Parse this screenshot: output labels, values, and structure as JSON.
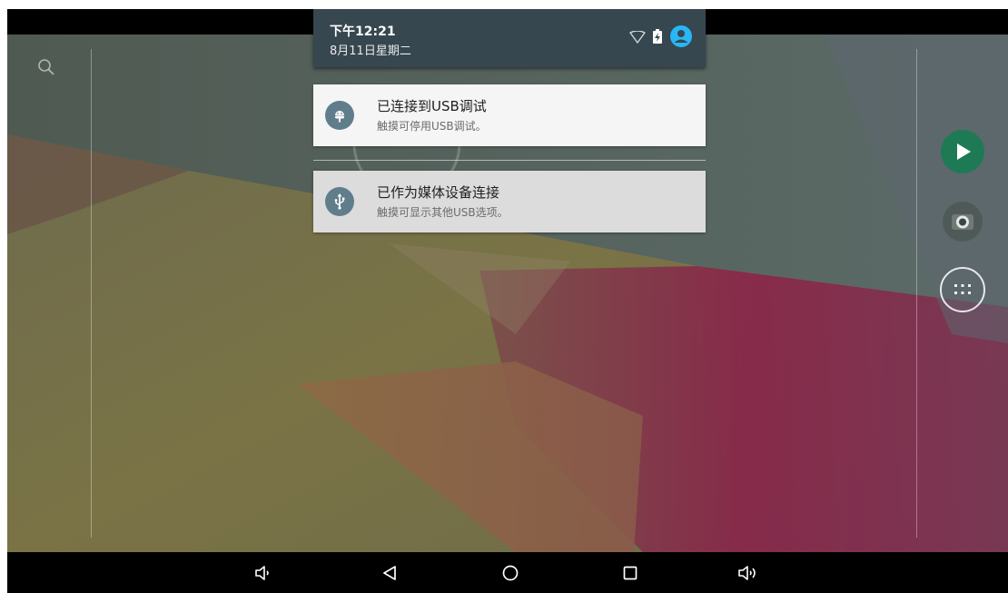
{
  "status_bar": {
    "time": "下午12:21",
    "date": "8月11日星期二"
  },
  "notifications": [
    {
      "title": "已连接到USB调试",
      "text": "触摸可停用USB调试。",
      "icon": "android-debug-icon"
    },
    {
      "title": "已作为媒体设备连接",
      "text": "触摸可显示其他USB选项。",
      "icon": "usb-icon"
    }
  ],
  "colors": {
    "shade_header": "#37474f",
    "notification_icon_bg": "#607d8b",
    "play_store_green": "#1e7a54",
    "account_icon": "#29b6f6"
  },
  "icons": {
    "search": "search-icon",
    "wifi": "wifi-icon",
    "battery": "battery-charging-icon",
    "account": "account-icon",
    "play_store": "play-store-icon",
    "camera": "camera-icon",
    "app_drawer": "app-drawer-icon",
    "volume_down": "volume-down-icon",
    "back": "back-icon",
    "home": "home-icon",
    "recents": "recents-icon",
    "volume_up": "volume-up-icon"
  }
}
